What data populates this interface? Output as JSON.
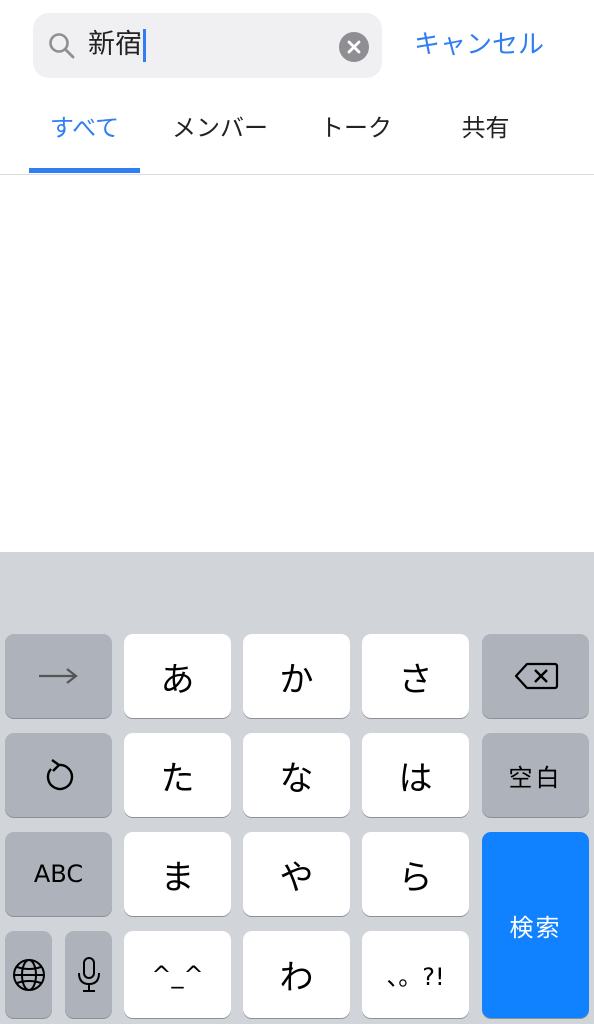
{
  "search": {
    "query": "新宿",
    "cancel_label": "キャンセル"
  },
  "tabs": [
    {
      "label": "すべて",
      "active": true
    },
    {
      "label": "メンバー",
      "active": false
    },
    {
      "label": "トーク",
      "active": false
    },
    {
      "label": "共有",
      "active": false
    }
  ],
  "colors": {
    "accent": "#2f7ff3",
    "keyboard_bg": "#d1d4d9",
    "special_key": "#aeb3bb",
    "search_key": "#1082ff"
  },
  "keyboard": {
    "row1": [
      "あ",
      "か",
      "さ"
    ],
    "row2": [
      "た",
      "な",
      "は"
    ],
    "row3": [
      "ま",
      "や",
      "ら"
    ],
    "row4": [
      "^_^",
      "わ",
      "、。?!"
    ],
    "space_label": "空白",
    "abc_label": "ABC",
    "search_label": "検索",
    "icons": [
      "arrow-right-icon",
      "undo-icon",
      "globe-icon",
      "mic-icon",
      "backspace-icon"
    ]
  }
}
